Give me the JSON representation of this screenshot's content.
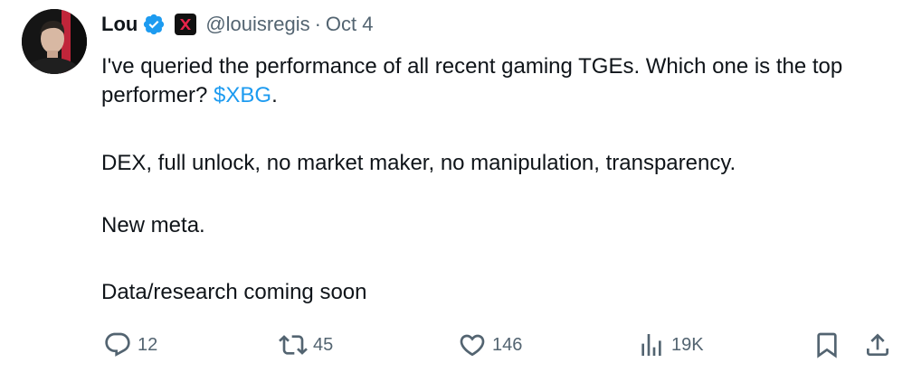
{
  "author": {
    "display_name": "Lou",
    "handle": "@louisregis",
    "separator": "·",
    "date": "Oct 4",
    "verified_icon": "verified-badge-icon",
    "affiliate_icon": "affiliate-x-logo-icon",
    "avatar_icon": "profile-photo"
  },
  "tweet": {
    "line1_before": "I've queried the performance of all recent gaming TGEs. Which one is the top performer? ",
    "cashtag": "$XBG",
    "line1_after": ".",
    "line2": "DEX, full unlock, no market maker, no manipulation, transparency.",
    "line3": "New meta.",
    "line4": "Data/research coming soon"
  },
  "actions": {
    "reply": {
      "icon": "reply-icon",
      "count": "12"
    },
    "retweet": {
      "icon": "retweet-icon",
      "count": "45"
    },
    "like": {
      "icon": "heart-icon",
      "count": "146"
    },
    "views": {
      "icon": "views-chart-icon",
      "count": "19K"
    },
    "bookmark": {
      "icon": "bookmark-icon"
    },
    "share": {
      "icon": "share-icon"
    }
  },
  "colors": {
    "text": "#0f1419",
    "secondary": "#536471",
    "accent": "#1d9bf0",
    "affiliate_accent": "#e8234a"
  }
}
